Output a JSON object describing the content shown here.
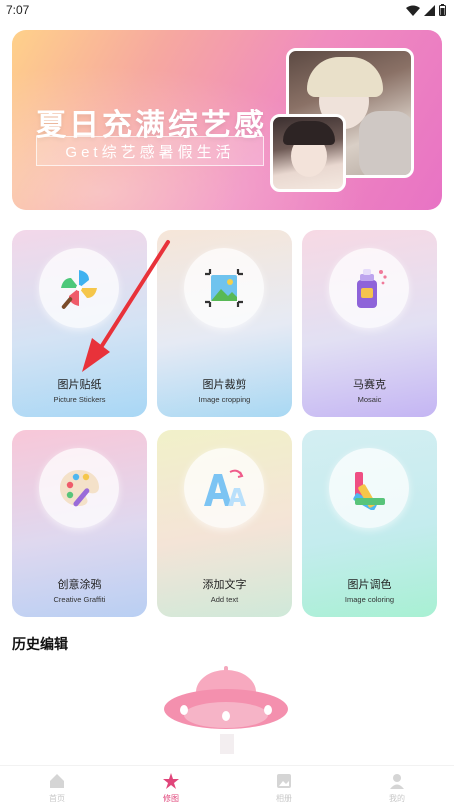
{
  "status_bar": {
    "time": "7:07"
  },
  "banner": {
    "title": "夏日充满综艺感",
    "subtitle": "Get综艺感暑假生活"
  },
  "tools": [
    {
      "label": "图片贴纸",
      "sublabel": "Picture Stickers",
      "icon": "pinwheel-icon"
    },
    {
      "label": "图片裁剪",
      "sublabel": "Image cropping",
      "icon": "crop-image-icon"
    },
    {
      "label": "马赛克",
      "sublabel": "Mosaic",
      "icon": "spray-paint-icon"
    },
    {
      "label": "创意涂鸦",
      "sublabel": "Creative Graffiti",
      "icon": "palette-icon"
    },
    {
      "label": "添加文字",
      "sublabel": "Add text",
      "icon": "text-aa-icon"
    },
    {
      "label": "图片调色",
      "sublabel": "Image coloring",
      "icon": "color-swatch-icon"
    }
  ],
  "history": {
    "title": "历史编辑"
  },
  "bottom_nav": [
    {
      "label": "首页",
      "icon": "home-icon",
      "active": false
    },
    {
      "label": "修图",
      "icon": "star-edit-icon",
      "active": true
    },
    {
      "label": "相册",
      "icon": "album-icon",
      "active": false
    },
    {
      "label": "我的",
      "icon": "profile-icon",
      "active": false
    }
  ],
  "colors": {
    "accent": "#e0457a",
    "annotation_arrow": "#e8323a"
  }
}
